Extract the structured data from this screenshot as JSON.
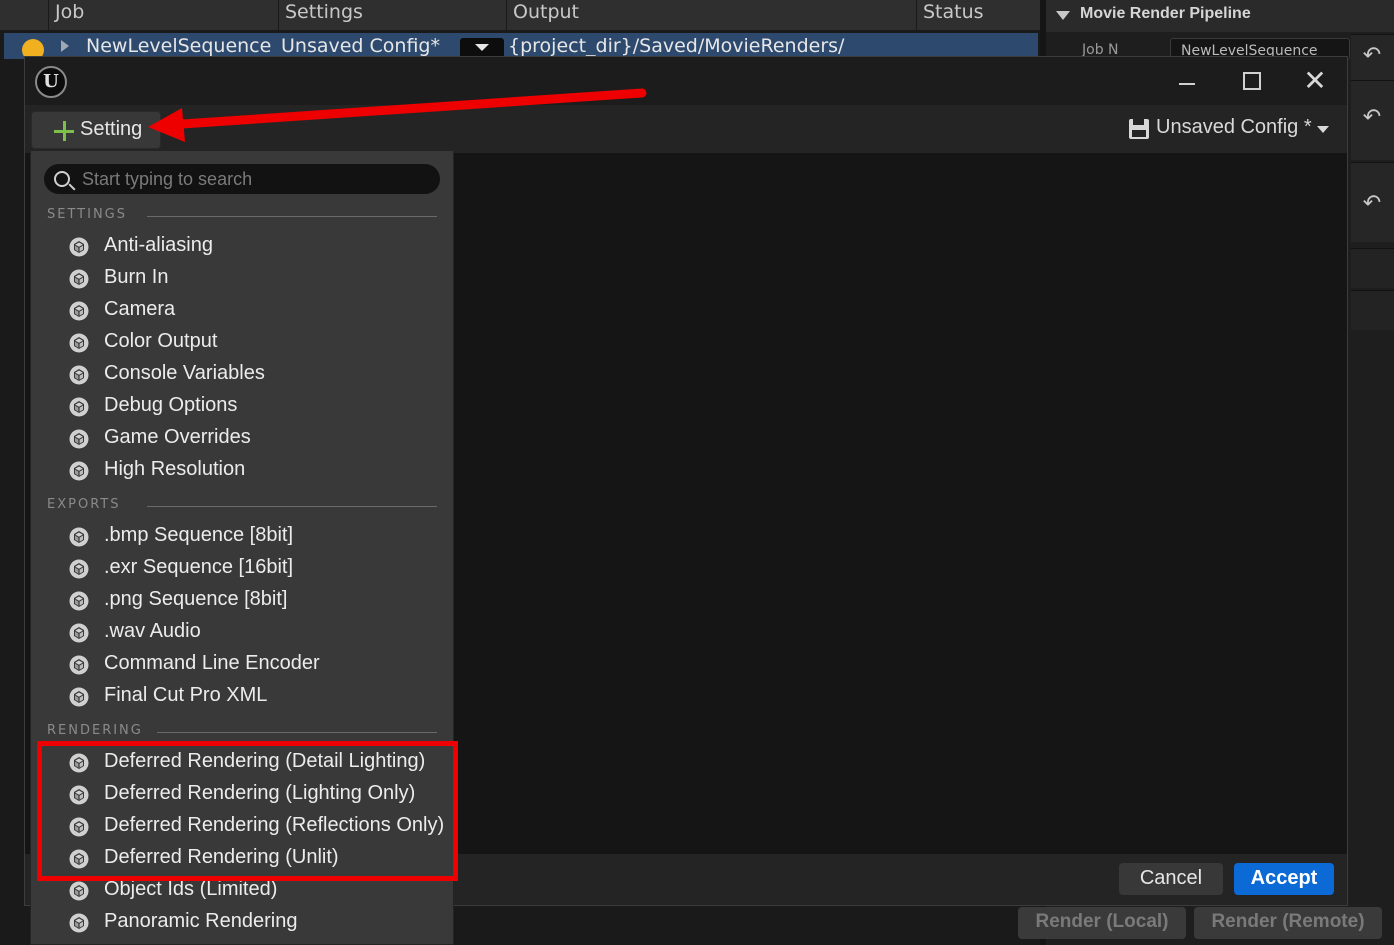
{
  "queue": {
    "columns": [
      "Job",
      "Settings",
      "Output",
      "Status"
    ],
    "row": {
      "job": "NewLevelSequence",
      "settings": "Unsaved Config*",
      "output": "{project_dir}/Saved/MovieRenders/"
    }
  },
  "details": {
    "title": "Movie Render Pipeline",
    "job_name_label": "Job N",
    "job_name_value": "NewLevelSequence"
  },
  "render_buttons": {
    "local": "Render (Local)",
    "remote": "Render (Remote)"
  },
  "dialog": {
    "add_setting_label": "Setting",
    "config_label": "Unsaved Config *",
    "cancel_label": "Cancel",
    "accept_label": "Accept"
  },
  "menu": {
    "search_placeholder": "Start typing to search",
    "sections": {
      "settings": {
        "title": "SETTINGS",
        "items": [
          "Anti-aliasing",
          "Burn In",
          "Camera",
          "Color Output",
          "Console Variables",
          "Debug Options",
          "Game Overrides",
          "High Resolution"
        ]
      },
      "exports": {
        "title": "EXPORTS",
        "items": [
          ".bmp Sequence [8bit]",
          ".exr Sequence [16bit]",
          ".png Sequence [8bit]",
          ".wav Audio",
          "Command Line Encoder",
          "Final Cut Pro XML"
        ]
      },
      "rendering": {
        "title": "RENDERING",
        "items": [
          "Deferred Rendering (Detail Lighting)",
          "Deferred Rendering (Lighting Only)",
          "Deferred Rendering (Reflections Only)",
          "Deferred Rendering (Unlit)",
          "Object Ids (Limited)",
          "Panoramic Rendering"
        ]
      }
    }
  },
  "colors": {
    "accent_blue": "#0b6ad6",
    "plus_green": "#7cc04a",
    "annotation_red": "#ee0000"
  }
}
